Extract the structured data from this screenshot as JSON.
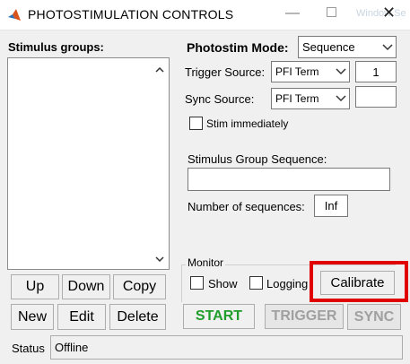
{
  "window": {
    "title": "PHOTOSTIMULATION CONTROLS",
    "ghost_title": "Window Se",
    "minimize_symbol": "—",
    "close_symbol": "✕"
  },
  "left": {
    "stimulus_groups_label": "Stimulus groups:",
    "buttons": {
      "up": "Up",
      "down": "Down",
      "copy": "Copy",
      "new": "New",
      "edit": "Edit",
      "delete": "Delete"
    }
  },
  "right": {
    "photostim_mode_label": "Photostim Mode:",
    "photostim_mode_value": "Sequence",
    "trigger_source_label": "Trigger Source:",
    "trigger_source_value": "PFI Term",
    "trigger_count_value": "1",
    "sync_source_label": "Sync Source:",
    "sync_source_value": "PFI Term",
    "sync_value": "",
    "stim_immediately_label": "Stim immediately",
    "stim_immediately_checked": false,
    "sequence_label": "Stimulus Group Sequence:",
    "sequence_value": "",
    "num_sequences_label": "Number of sequences:",
    "num_sequences_value": "Inf"
  },
  "monitor": {
    "title": "Monitor",
    "show_label": "Show",
    "show_checked": false,
    "logging_label": "Logging",
    "logging_checked": false,
    "calibrate_label": "Calibrate"
  },
  "actions": {
    "start_label": "START",
    "trigger_label": "TRIGGER",
    "sync_label": "SYNC",
    "start_color": "#1f9d2b",
    "disabled_color": "#a0a0a0"
  },
  "status": {
    "label": "Status",
    "value": "Offline"
  },
  "colors": {
    "highlight": "#e00000"
  }
}
